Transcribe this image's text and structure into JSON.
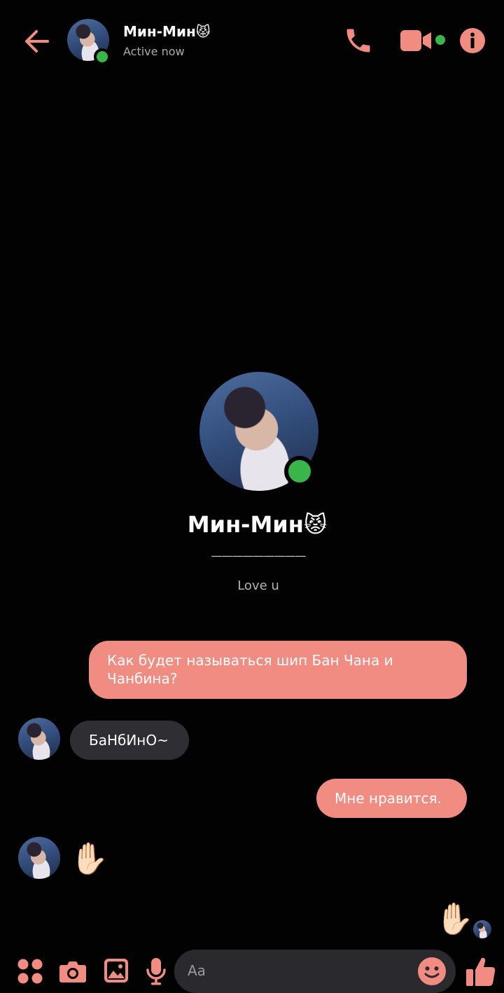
{
  "header": {
    "contact_name": "Мин-Мин😾",
    "status": "Active now"
  },
  "profile": {
    "name": "Мин-Мин😾",
    "divider": "—————————",
    "bio": "Love u"
  },
  "messages": [
    {
      "from": "me",
      "text": "Как будет называться шип Бан Чана и Чанбина?"
    },
    {
      "from": "contact",
      "text": "БаНбИнО~"
    },
    {
      "from": "me",
      "text": "Мне нравится."
    },
    {
      "from": "contact",
      "text": "✋🏻"
    },
    {
      "from": "me",
      "text": "✋🏻"
    }
  ],
  "composer": {
    "placeholder": "Aa"
  },
  "colors": {
    "accent": "#f08c82",
    "background": "#030203",
    "incoming_bubble": "#2f2f33",
    "online": "#39b54a"
  },
  "icons": {
    "back": "arrow-left-icon",
    "call": "phone-icon",
    "video": "video-camera-icon",
    "info": "info-icon",
    "more": "four-dots-icon",
    "camera": "camera-icon",
    "gallery": "image-icon",
    "mic": "microphone-icon",
    "emoji": "smiley-icon",
    "like": "thumbs-up-icon"
  }
}
